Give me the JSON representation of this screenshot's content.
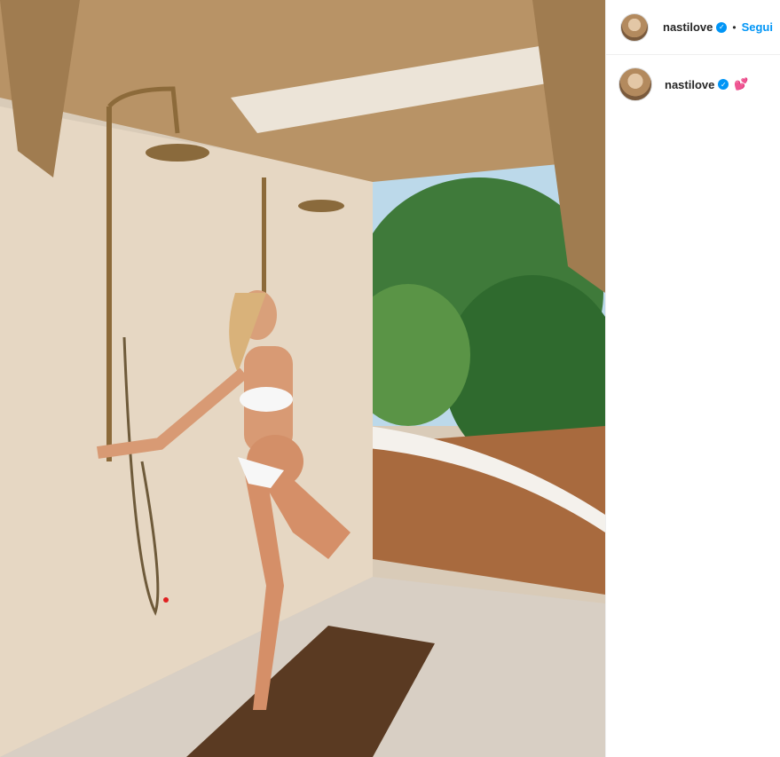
{
  "post": {
    "image_alt": "photo"
  },
  "header": {
    "username": "nastilove",
    "verified_glyph": "✓",
    "separator": "•",
    "follow_label": "Segui"
  },
  "caption": {
    "username": "nastilove",
    "verified_glyph": "✓",
    "emoji": "💕"
  },
  "colors": {
    "accent": "#0095f6",
    "text": "#262626",
    "border": "#efefef"
  }
}
